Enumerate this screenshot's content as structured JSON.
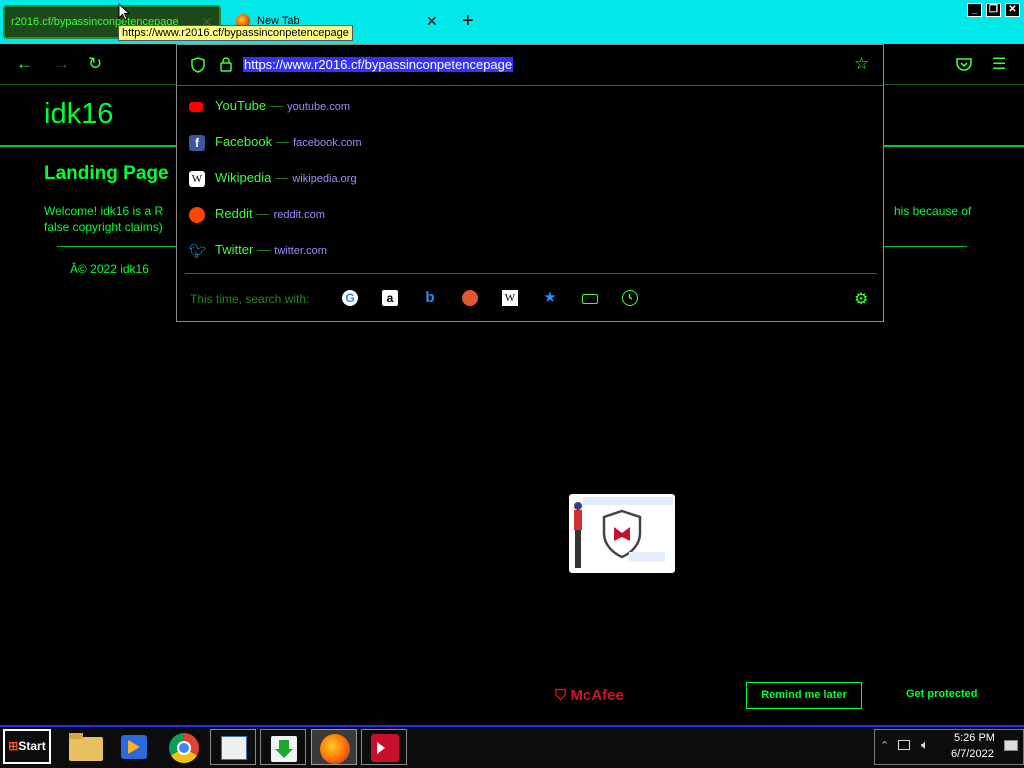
{
  "browser": {
    "tabs": [
      {
        "title": "r2016.cf/bypassinconpetencepage",
        "active": true
      },
      {
        "title": "New Tab",
        "active": false
      }
    ],
    "tooltip": "https://www.r2016.cf/bypassinconpetencepage",
    "address": "https://www.r2016.cf/bypassinconpetencepage",
    "suggestions": [
      {
        "name": "YouTube",
        "domain": "youtube.com",
        "color": "#ff0000"
      },
      {
        "name": "Facebook",
        "domain": "facebook.com",
        "color": "#3b5998"
      },
      {
        "name": "Wikipedia",
        "domain": "wikipedia.org",
        "color": "#ffffff"
      },
      {
        "name": "Reddit",
        "domain": "reddit.com",
        "color": "#ff4500"
      },
      {
        "name": "Twitter",
        "domain": "twitter.com",
        "color": "#1da1f2"
      }
    ],
    "search_with_label": "This time, search with:",
    "search_engines": [
      "google-icon",
      "amazon-icon",
      "bing-icon",
      "duckduckgo-icon",
      "wikipedia-icon",
      "bookmarks-icon",
      "tabs-icon",
      "history-icon"
    ]
  },
  "page": {
    "site_title": "idk16",
    "heading": "Landing Page",
    "body_line1": "Welcome! idk16 is a R",
    "body_line1_end": "his because of",
    "body_line2": "false copyright claims)",
    "footer": "Â© 2022 idk16"
  },
  "mcafee": {
    "logo": "McAfee",
    "remind": "Remind me later",
    "protect": "Get protected"
  },
  "taskbar": {
    "start": "Start",
    "time": "5:26 PM",
    "date": "6/7/2022"
  }
}
